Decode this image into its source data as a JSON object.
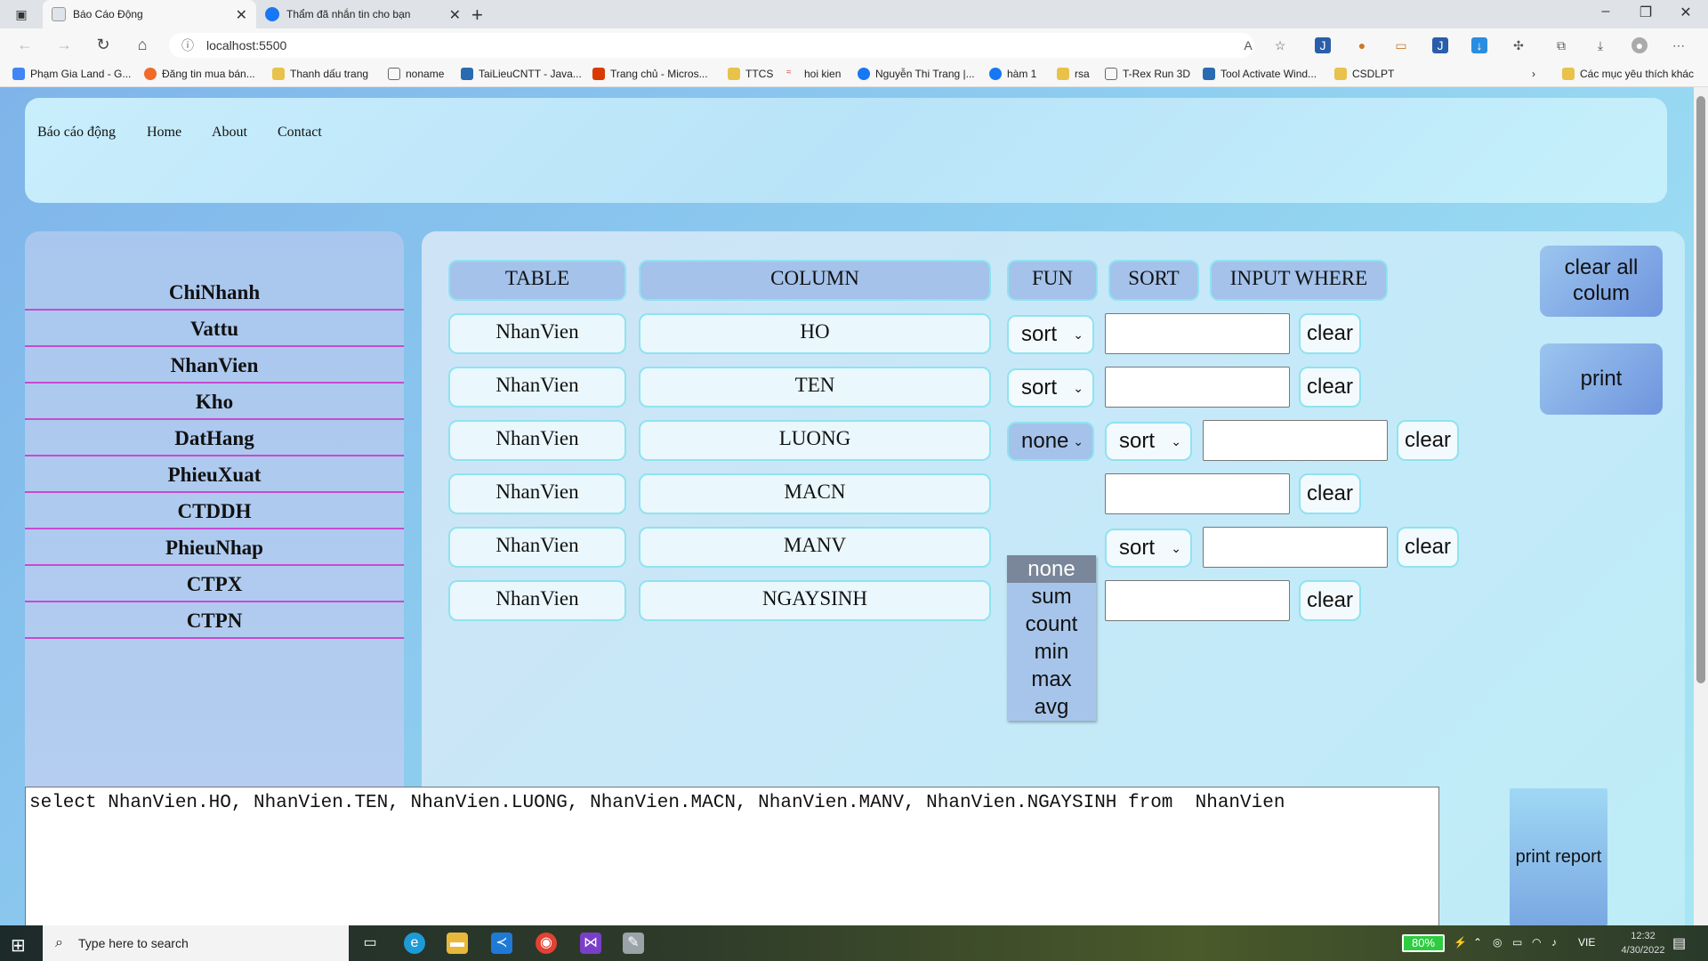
{
  "browser": {
    "tabs": [
      {
        "title": "Báo Cáo Động",
        "active": true
      },
      {
        "title": "Thẩm đã nhắn tin cho bạn",
        "active": false
      }
    ],
    "url": "localhost:5500",
    "bookmarks": [
      "Phạm Gia Land - G...",
      "Đăng tin mua bán...",
      "Thanh dấu trang",
      "noname",
      "TaiLieuCNTT - Java...",
      "Trang chủ - Micros...",
      "TTCS",
      "hoi kien",
      "Nguyễn Thi Trang |...",
      "hàm 1",
      "rsa",
      "T-Rex Run 3D",
      "Tool Activate Wind...",
      "CSDLPT"
    ],
    "bookmarks_other": "Các mục yêu thích khác"
  },
  "navbar": {
    "brand": "Báo cáo động",
    "links": [
      "Home",
      "About",
      "Contact"
    ]
  },
  "sidebar": {
    "items": [
      "ChiNhanh",
      "Vattu",
      "NhanVien",
      "Kho",
      "DatHang",
      "PhieuXuat",
      "CTDDH",
      "PhieuNhap",
      "CTPX",
      "CTPN"
    ]
  },
  "headers": {
    "table": "TABLE",
    "column": "COLUMN",
    "fun": "FUN",
    "sort": "SORT",
    "input_where": "INPUT WHERE"
  },
  "rows": [
    {
      "table": "NhanVien",
      "column": "HO",
      "sort": "sort",
      "clear": "clear"
    },
    {
      "table": "NhanVien",
      "column": "TEN",
      "sort": "sort",
      "clear": "clear"
    },
    {
      "table": "NhanVien",
      "column": "LUONG",
      "fun": "none",
      "sort": "sort",
      "clear": "clear"
    },
    {
      "table": "NhanVien",
      "column": "MACN",
      "clear": "clear"
    },
    {
      "table": "NhanVien",
      "column": "MANV",
      "sort": "sort",
      "clear": "clear"
    },
    {
      "table": "NhanVien",
      "column": "NGAYSINH",
      "clear": "clear"
    }
  ],
  "fun_dropdown": {
    "options": [
      "none",
      "sum",
      "count",
      "min",
      "max",
      "avg"
    ],
    "selected": "none"
  },
  "buttons": {
    "clear_all_line1": "clear all",
    "clear_all_line2": "colum",
    "print": "print",
    "print_report": "print report"
  },
  "query": "select NhanVien.HO, NhanVien.TEN, NhanVien.LUONG, NhanVien.MACN, NhanVien.MANV, NhanVien.NGAYSINH from  NhanVien",
  "taskbar": {
    "search_placeholder": "Type here to search",
    "battery": "80%",
    "language": "VIE",
    "time": "12:32",
    "date": "4/30/2022"
  },
  "colors": {
    "accent_border": "#8fe3f0",
    "sidebar_divider": "#c64bd0",
    "header_fill": "#a4c2ea"
  }
}
